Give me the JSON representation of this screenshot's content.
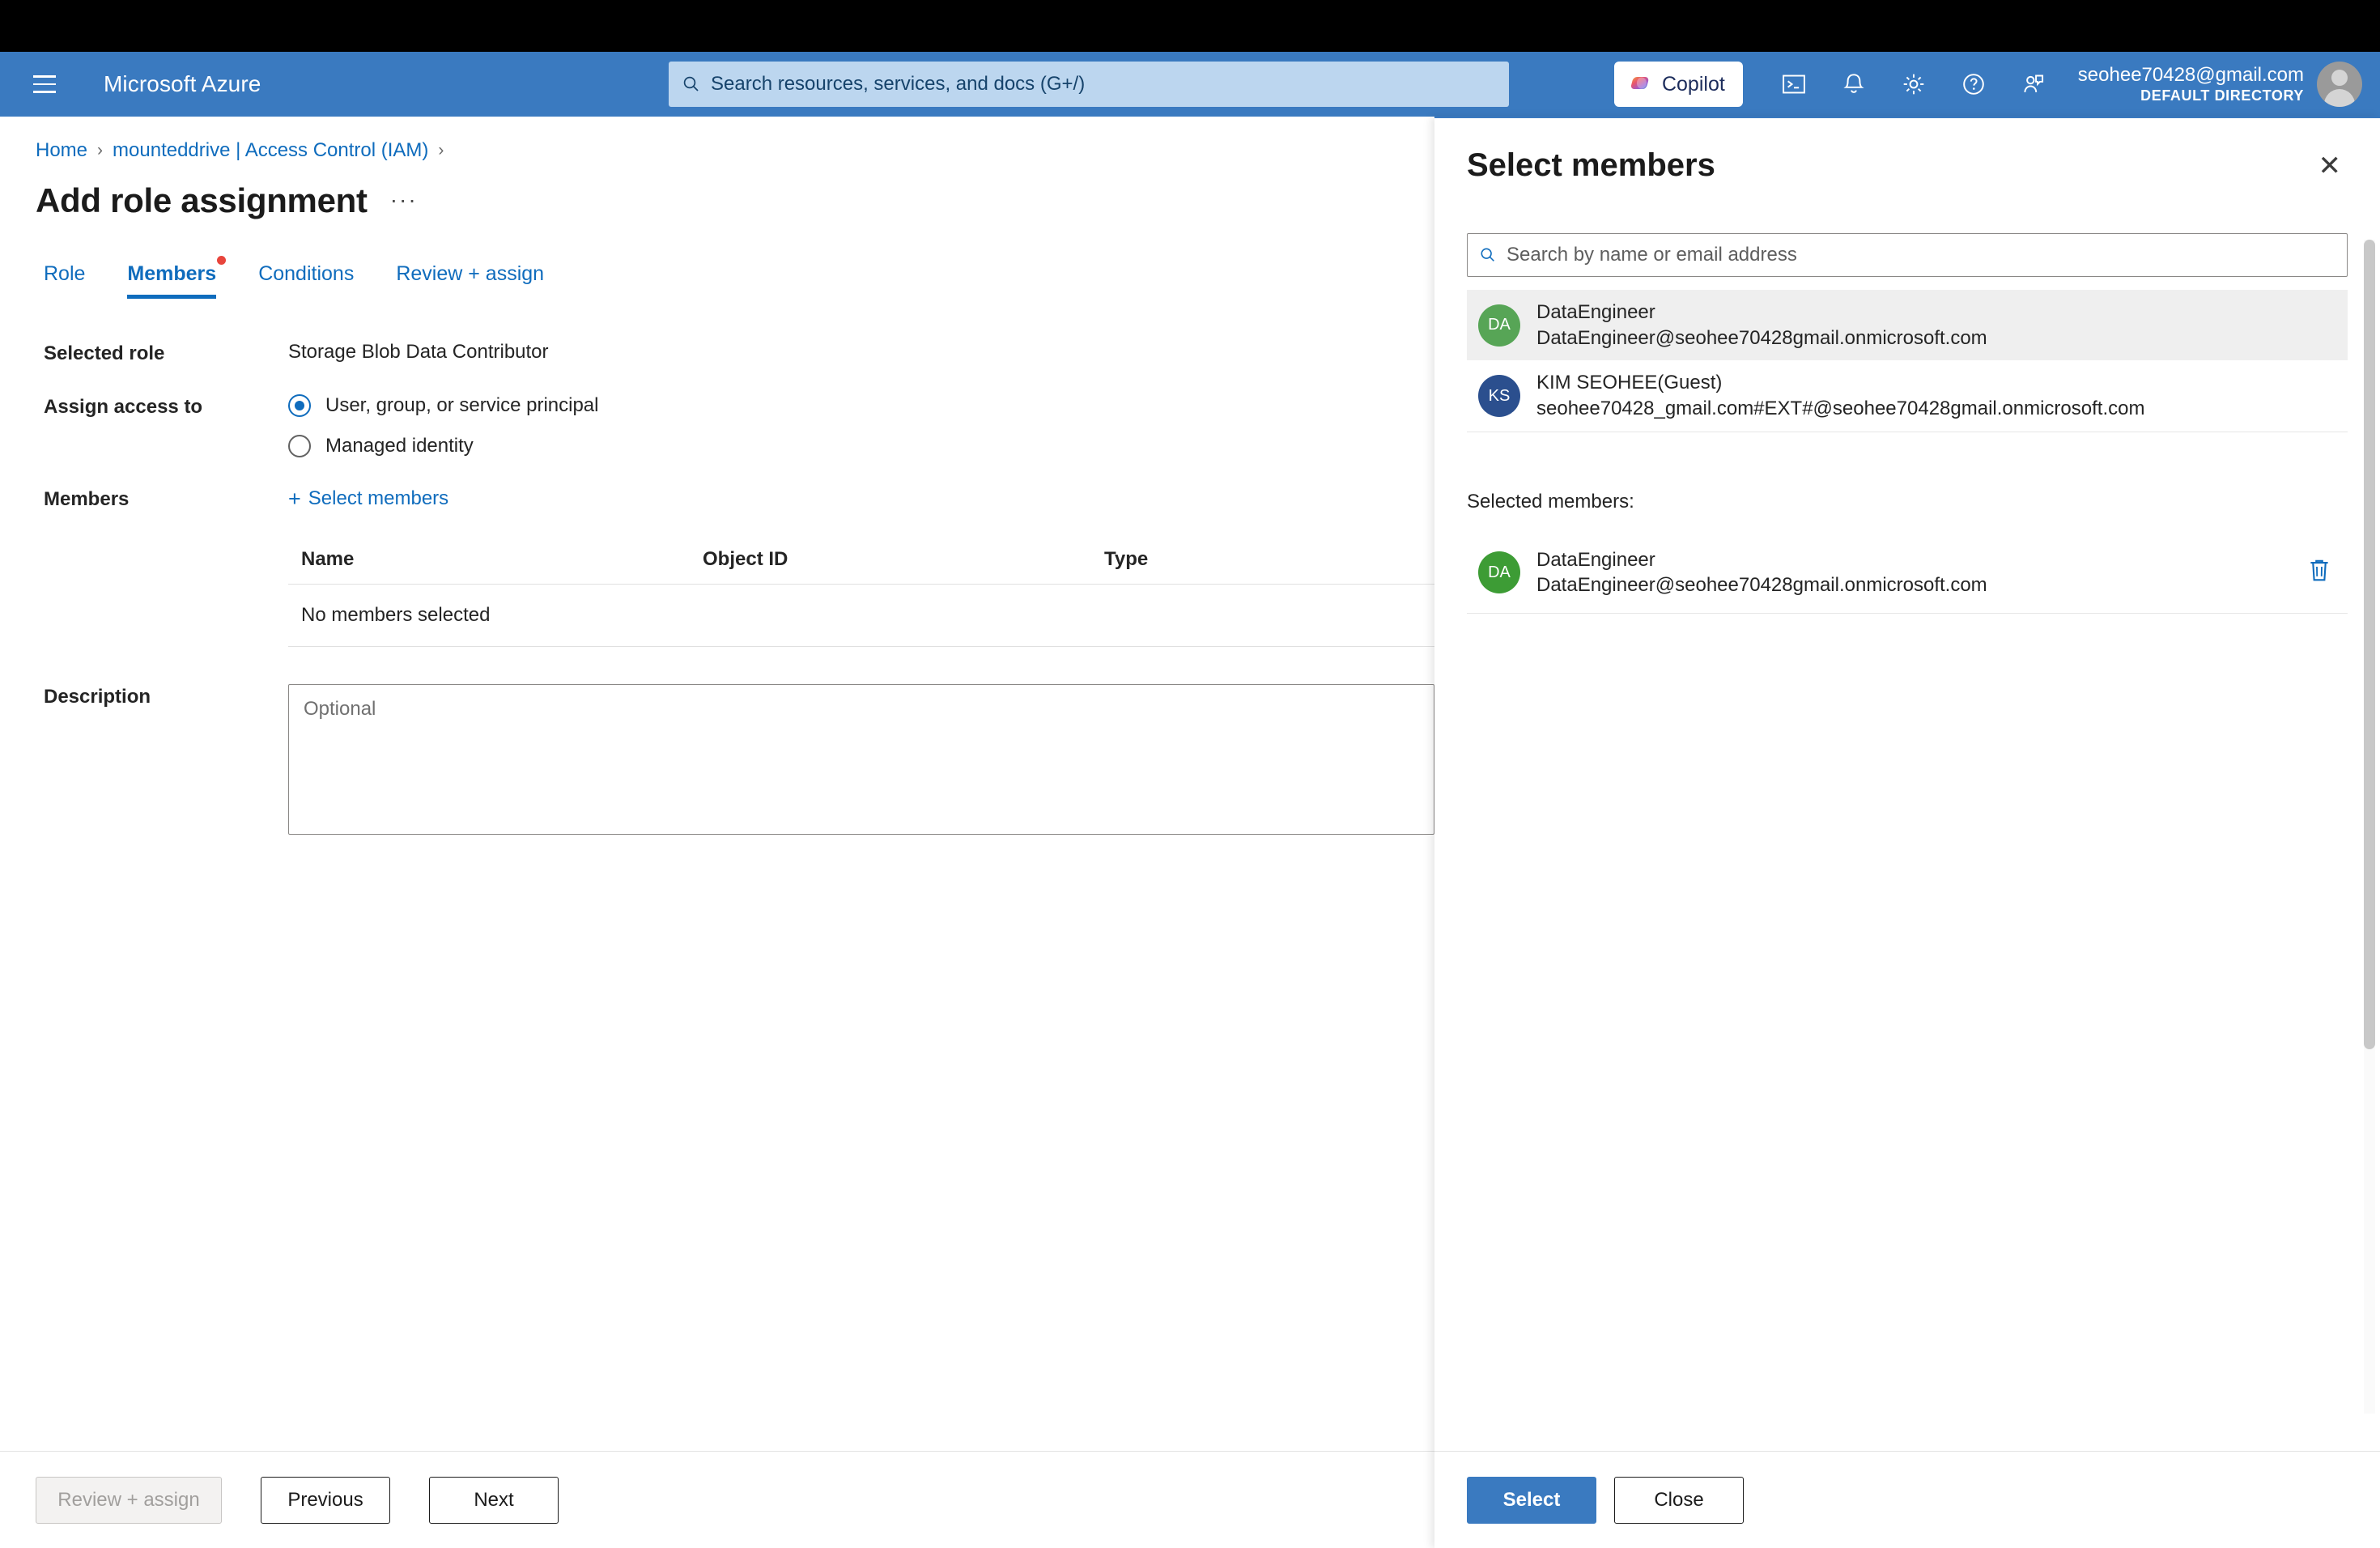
{
  "topnav": {
    "brand": "Microsoft Azure",
    "menu_icon": "hamburger-icon",
    "search_placeholder": "Search resources, services, and docs (G+/)",
    "copilot_label": "Copilot",
    "icons": [
      "cloud-shell-icon",
      "notifications-icon",
      "settings-icon",
      "help-icon",
      "feedback-icon"
    ],
    "user_email": "seohee70428@gmail.com",
    "user_directory": "DEFAULT DIRECTORY"
  },
  "breadcrumb": {
    "home": "Home",
    "separator": "›",
    "parent": "mounteddrive | Access Control (IAM)"
  },
  "page": {
    "title": "Add role assignment",
    "ellipsis": "···"
  },
  "tabs": [
    {
      "label": "Role",
      "active": false,
      "required": false
    },
    {
      "label": "Members",
      "active": true,
      "required": true
    },
    {
      "label": "Conditions",
      "active": false,
      "required": false
    },
    {
      "label": "Review + assign",
      "active": false,
      "required": false
    }
  ],
  "form": {
    "selected_role_label": "Selected role",
    "selected_role_value": "Storage Blob Data Contributor",
    "assign_access_label": "Assign access to",
    "assign_options": [
      {
        "label": "User, group, or service principal",
        "checked": true
      },
      {
        "label": "Managed identity",
        "checked": false
      }
    ],
    "members_label": "Members",
    "select_members_link": "Select members",
    "plus_glyph": "+",
    "table": {
      "columns": [
        "Name",
        "Object ID",
        "Type"
      ],
      "empty_text": "No members selected",
      "rows": []
    },
    "description_label": "Description",
    "description_placeholder": "Optional",
    "description_value": ""
  },
  "footer": {
    "review_assign": "Review + assign",
    "previous": "Previous",
    "next": "Next"
  },
  "panel": {
    "title": "Select members",
    "close_icon": "close-icon",
    "search_placeholder": "Search by name or email address",
    "search_value": "",
    "results": [
      {
        "initials": "DA",
        "avatar_color": "#57a556",
        "name": "DataEngineer",
        "email": "DataEngineer@seohee70428gmail.onmicrosoft.com",
        "highlighted": true
      },
      {
        "initials": "KS",
        "avatar_color": "#2b4f8e",
        "name": "KIM SEOHEE(Guest)",
        "email": "seohee70428_gmail.com#EXT#@seohee70428gmail.onmicrosoft.com",
        "highlighted": false
      }
    ],
    "selected_label": "Selected members:",
    "selected": [
      {
        "initials": "DA",
        "avatar_color": "#3d9c35",
        "name": "DataEngineer",
        "email": "DataEngineer@seohee70428gmail.onmicrosoft.com",
        "remove_icon": "trash-icon"
      }
    ],
    "footer": {
      "select": "Select",
      "close": "Close"
    }
  },
  "colors": {
    "azure_blue": "#3a7ac0",
    "link_blue": "#0f6cbd",
    "required_red": "#e8453c"
  }
}
